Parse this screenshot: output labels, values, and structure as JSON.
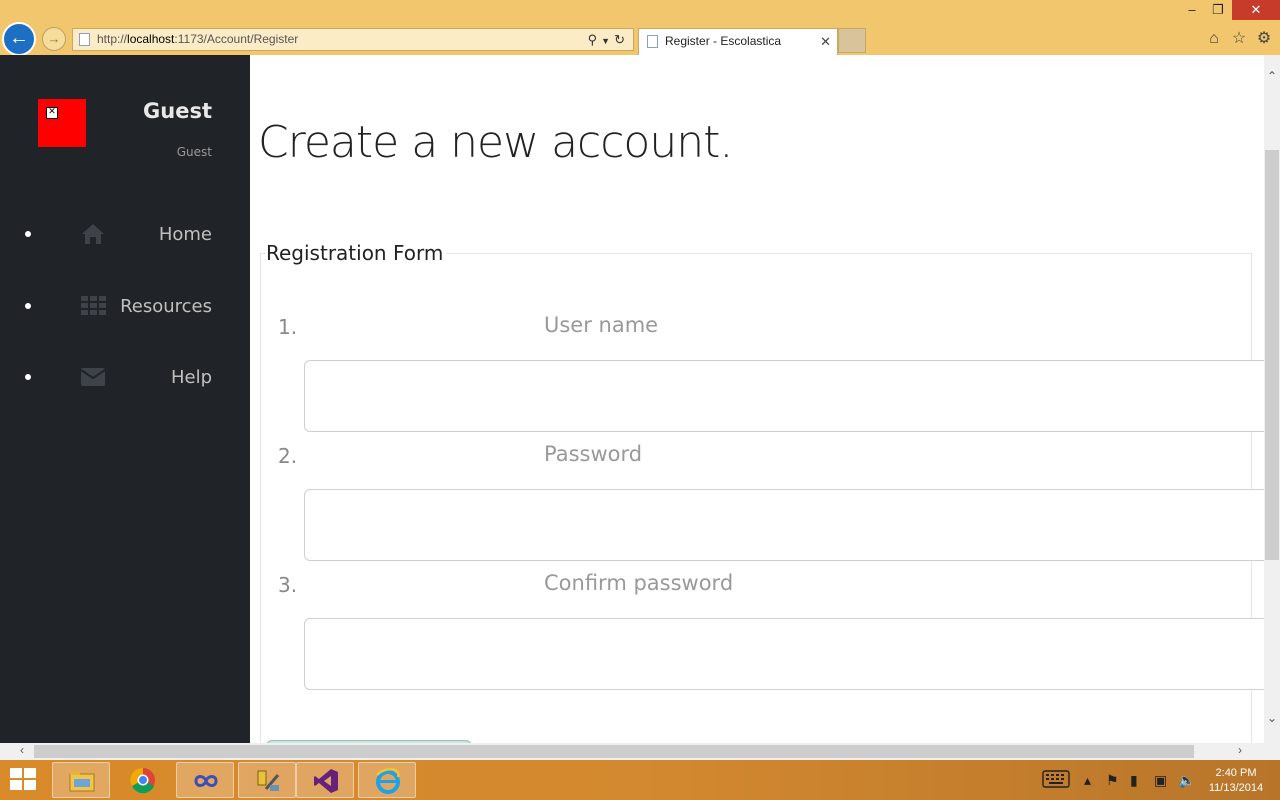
{
  "browser": {
    "url_prefix": "http://",
    "url_host": "localhost",
    "url_rest": ":1173/Account/Register",
    "tab_title": "Register - Escolastica",
    "window_controls": {
      "minimize": "–",
      "restore": "❐",
      "close": "✕"
    },
    "icons": [
      "back-icon",
      "forward-icon",
      "search-icon",
      "refresh-icon",
      "home-icon",
      "star-icon",
      "gear-icon"
    ]
  },
  "sidebar": {
    "user_name": "Guest",
    "user_role": "Guest",
    "items": [
      {
        "label": "Home",
        "icon": "home-icon"
      },
      {
        "label": "Resources",
        "icon": "grid-icon"
      },
      {
        "label": "Help",
        "icon": "envelope-icon"
      }
    ]
  },
  "main": {
    "title": "Create a new account.",
    "legend": "Registration Form",
    "fields": [
      {
        "number": "1.",
        "label": "User name",
        "value": ""
      },
      {
        "number": "2.",
        "label": "Password",
        "value": ""
      },
      {
        "number": "3.",
        "label": "Confirm password",
        "value": ""
      }
    ]
  },
  "taskbar": {
    "apps": [
      "file-explorer-icon",
      "chrome-icon",
      "infinity-app-icon",
      "tools-icon",
      "visual-studio-icon",
      "internet-explorer-icon"
    ],
    "time": "2:40 PM",
    "date": "11/13/2014"
  },
  "colors": {
    "chrome_bg": "#f2c66d",
    "sidebar_bg": "#202327",
    "avatar": "#ff0000",
    "taskbar": "#d98a2a"
  }
}
